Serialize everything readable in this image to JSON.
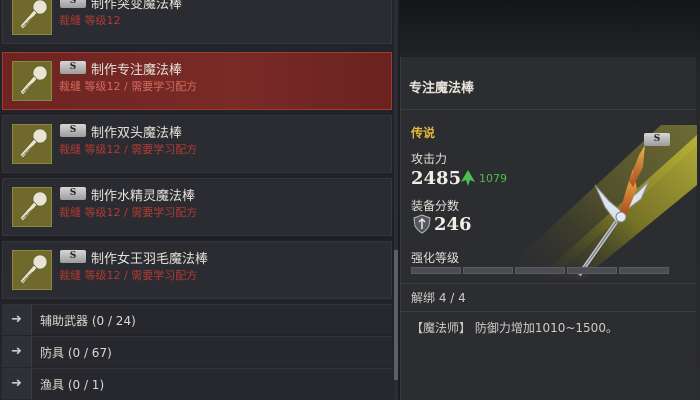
{
  "recipes": [
    {
      "name": "制作突变魔法棒",
      "req": "裁缝 等级12",
      "badge": "S",
      "selected": false,
      "icon": "staff-material-icon"
    },
    {
      "name": "制作专注魔法棒",
      "req": "裁缝 等级12 / 需要学习配方",
      "badge": "S",
      "selected": true,
      "icon": "staff-material-icon"
    },
    {
      "name": "制作双头魔法棒",
      "req": "裁缝 等级12 / 需要学习配方",
      "badge": "S",
      "selected": false,
      "icon": "staff-material-icon"
    },
    {
      "name": "制作水精灵魔法棒",
      "req": "裁缝 等级12 / 需要学习配方",
      "badge": "S",
      "selected": false,
      "icon": "staff-material-icon"
    },
    {
      "name": "制作女王羽毛魔法棒",
      "req": "裁缝 等级12 / 需要学习配方",
      "badge": "S",
      "selected": false,
      "icon": "staff-material-icon"
    }
  ],
  "categories": [
    {
      "label": "辅助武器 (0 / 24)",
      "icon": "arrow-right-icon"
    },
    {
      "label": "防具 (0 / 67)",
      "icon": "arrow-right-icon"
    },
    {
      "label": "渔具 (0 / 1)",
      "icon": "arrow-right-icon"
    }
  ],
  "detail": {
    "title": "专注魔法棒",
    "badge": "S",
    "grade": "传说",
    "attack_label": "攻击力",
    "attack_value": "2485",
    "attack_increase": "1079",
    "score_label": "装备分数",
    "score_value": "246",
    "enhance_label": "强化等级",
    "enhance_segments": 5,
    "bind_text": "解绑 4 / 4",
    "effect_text": "【魔法师】 防御力增加1010~1500。",
    "weapon_icon": "magic-staff-icon"
  },
  "colors": {
    "selected_bg": "#7a2a27",
    "requirement_red": "#b23a34",
    "grade_gold": "#e2b93b",
    "increase_green": "#4fbf4f",
    "thumb_olive": "#6f6a2c"
  }
}
